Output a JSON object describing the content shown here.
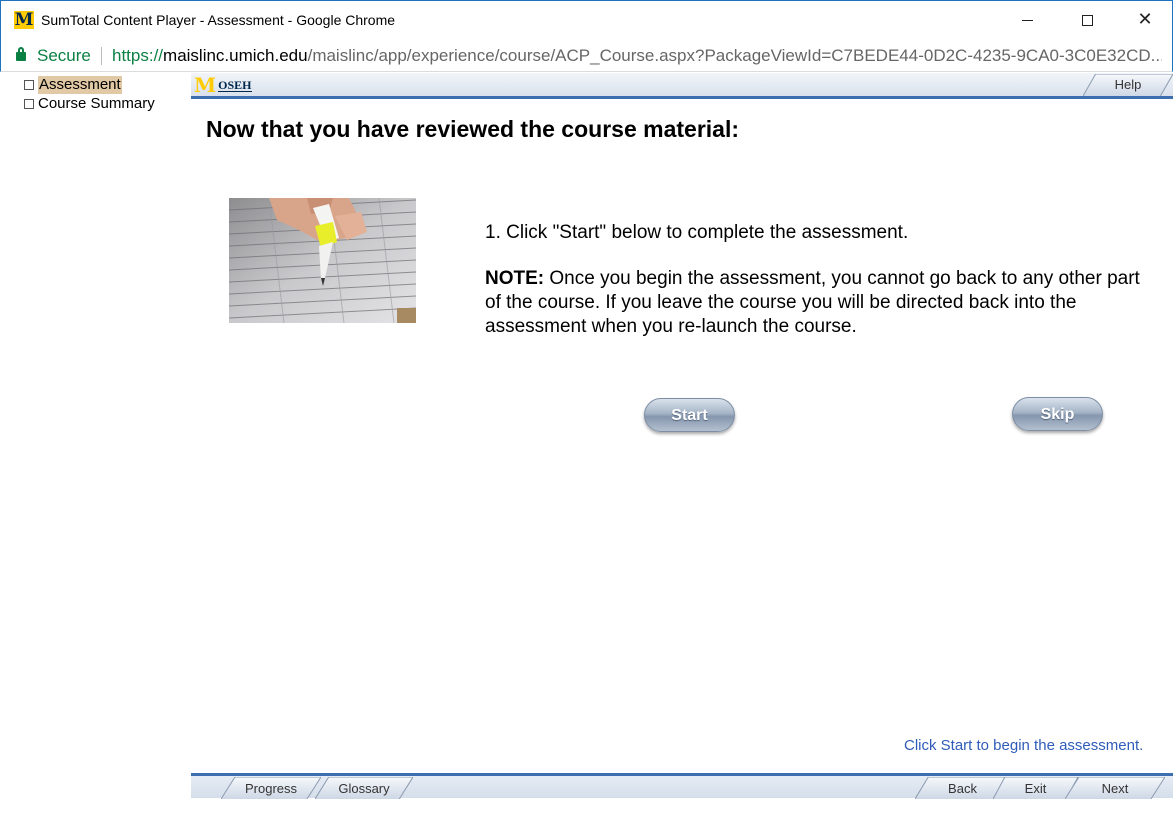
{
  "window": {
    "title": "SumTotal Content Player - Assessment - Google Chrome",
    "logo_letter": "M",
    "close_glyph": "✕"
  },
  "addressbar": {
    "secure_label": "Secure",
    "url_scheme": "https://",
    "url_host": "maislinc.umich.edu",
    "url_path": "/maislinc/app/experience/course/ACP_Course.aspx?PackageViewId=C7BEDE44-0D2C-4235-9CA0-3C0E32CD..."
  },
  "toc": {
    "items": [
      {
        "label": "Assessment",
        "selected": true
      },
      {
        "label": "Course Summary",
        "selected": false
      }
    ]
  },
  "header": {
    "logo_m": "M",
    "logo_text": "OSEH",
    "help_label": "Help"
  },
  "content": {
    "heading": "Now that you have reviewed the course material:",
    "step1": "1. Click \"Start\" below to complete the assessment.",
    "note_label": "NOTE:",
    "note_text": " Once you begin the assessment, you cannot go back to any other part of the course. If you leave the course you will be directed back into the assessment when you re-launch the course.",
    "start_label": "Start",
    "skip_label": "Skip",
    "hint": "Click Start to begin the assessment."
  },
  "footer": {
    "progress_label": "Progress",
    "glossary_label": "Glossary",
    "back_label": "Back",
    "exit_label": "Exit",
    "next_label": "Next"
  },
  "colors": {
    "accent_blue": "#3d6fb0",
    "hint_blue": "#2f5cb8",
    "secure_green": "#0b8043",
    "selected_highlight": "#e2c9a6",
    "umich_maize": "#ffcb05"
  },
  "icons": [
    "michigan-m-logo",
    "lock-icon",
    "minimize-icon",
    "maximize-icon",
    "close-icon",
    "checkbox-icon",
    "oseh-logo"
  ]
}
